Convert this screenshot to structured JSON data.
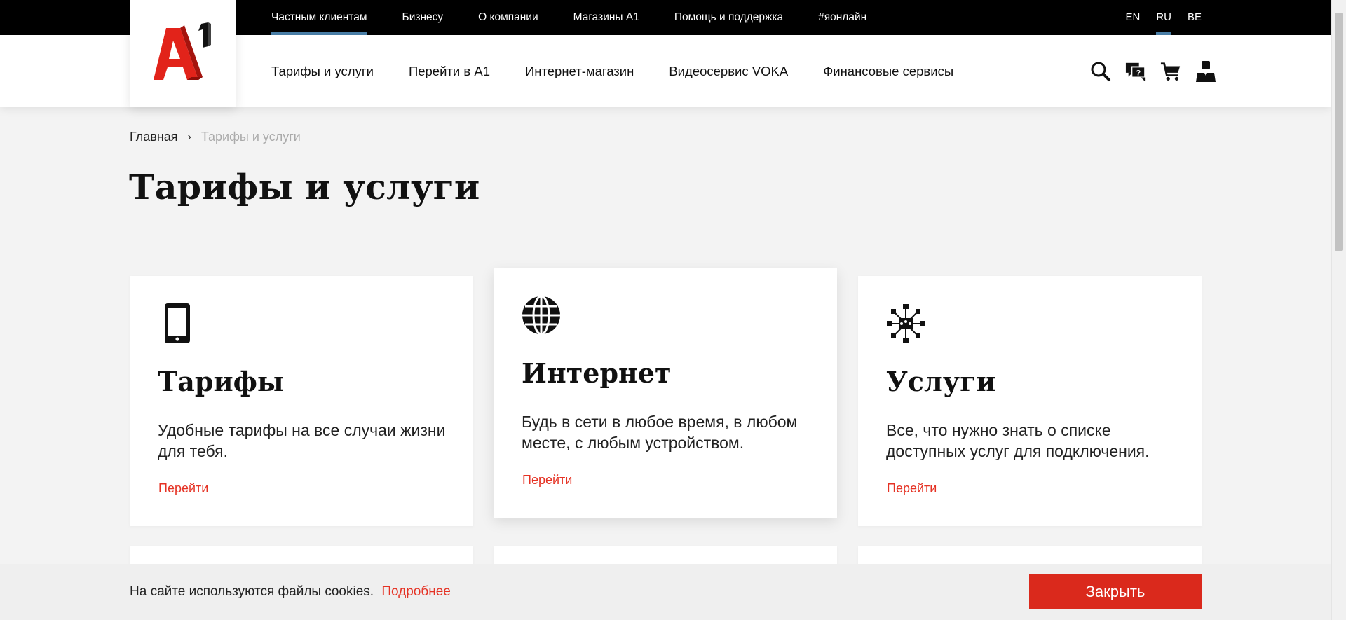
{
  "topnav": {
    "items": [
      "Частным клиентам",
      "Бизнесу",
      "О компании",
      "Магазины А1",
      "Помощь и поддержка",
      "#яонлайн"
    ],
    "active_index": 0
  },
  "languages": {
    "items": [
      "EN",
      "RU",
      "BE"
    ],
    "active": "RU"
  },
  "logo": {
    "text": "A1",
    "color": "#e2231a"
  },
  "mainnav": {
    "items": [
      "Тарифы и услуги",
      "Перейти в А1",
      "Интернет-магазин",
      "Видеосервис VOKA",
      "Финансовые сервисы"
    ]
  },
  "tools": {
    "icons": [
      "search-icon",
      "help-chat-icon",
      "cart-icon",
      "user-icon"
    ]
  },
  "breadcrumb": {
    "home": "Главная",
    "separator": "›",
    "current": "Тарифы и услуги"
  },
  "page": {
    "title": "Тарифы и услуги"
  },
  "cards": [
    {
      "icon": "smartphone-icon",
      "title": "Тарифы",
      "description": "Удобные тарифы на все случаи жизни для тебя.",
      "link": "Перейти"
    },
    {
      "icon": "globe-icon",
      "title": "Интернет",
      "description": "Будь в сети в любое время, в любом месте, с любым устройством.",
      "link": "Перейти"
    },
    {
      "icon": "network-services-icon",
      "title": "Услуги",
      "description": "Все, что нужно знать о списке доступных услуг для подключения.",
      "link": "Перейти"
    }
  ],
  "cookie": {
    "text": "На сайте используются файлы cookies.",
    "more": "Подробнее",
    "close": "Закрыть"
  },
  "colors": {
    "accent_red": "#e53224",
    "button_red": "#da291c",
    "active_underline": "#4a7fa8"
  }
}
